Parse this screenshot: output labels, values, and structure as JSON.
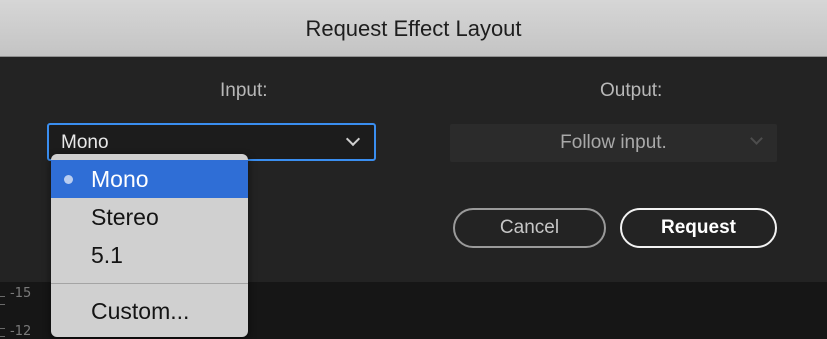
{
  "dialog": {
    "title": "Request Effect Layout",
    "input_label": "Input:",
    "output_label": "Output:",
    "input_value": "Mono",
    "output_value": "Follow input.",
    "cancel_label": "Cancel",
    "request_label": "Request"
  },
  "dropdown": {
    "items": [
      {
        "label": "Mono",
        "selected": true
      },
      {
        "label": "Stereo",
        "selected": false
      },
      {
        "label": "5.1",
        "selected": false
      },
      {
        "label": "Custom...",
        "selected": false
      }
    ]
  },
  "ruler": {
    "labels": [
      "-15",
      "-12"
    ]
  },
  "colors": {
    "accent": "#3a8ef0",
    "selection": "#2f6ed6",
    "dialog_bg": "#232323",
    "titlebar_bg": "#cccccc"
  }
}
